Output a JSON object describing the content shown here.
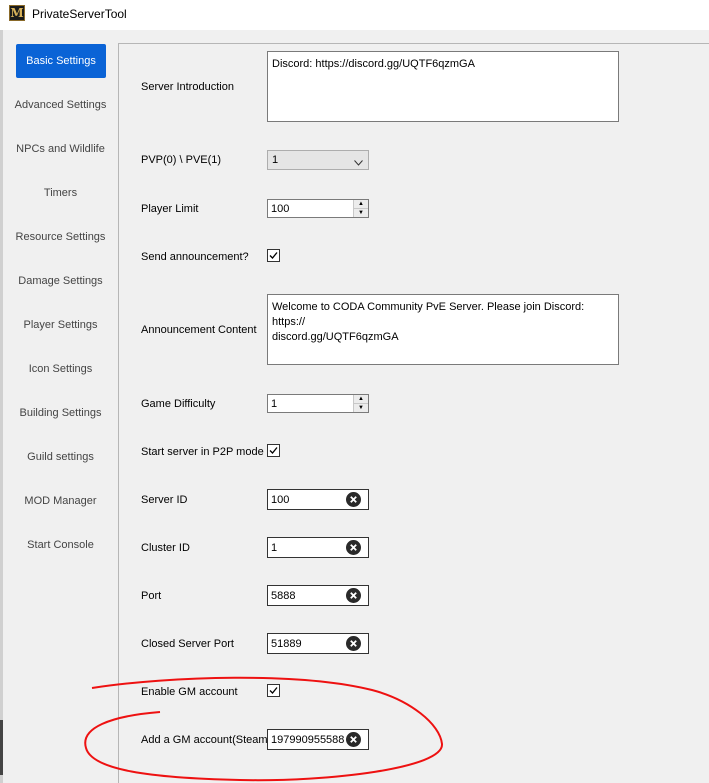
{
  "window": {
    "title": "PrivateServerTool",
    "icon": "app-logo-icon",
    "icon_letter": "M"
  },
  "nav": {
    "items": [
      {
        "label": "Basic Settings",
        "active": true
      },
      {
        "label": "Advanced Settings"
      },
      {
        "label": "NPCs and Wildlife"
      },
      {
        "label": "Timers"
      },
      {
        "label": "Resource Settings"
      },
      {
        "label": "Damage Settings"
      },
      {
        "label": "Player Settings"
      },
      {
        "label": "Icon Settings"
      },
      {
        "label": "Building Settings"
      },
      {
        "label": "Guild settings"
      },
      {
        "label": "MOD Manager"
      },
      {
        "label": "Start Console"
      }
    ]
  },
  "form": {
    "server_intro": {
      "label": "Server Introduction",
      "value": "Discord: https://discord.gg/UQTF6qzmGA"
    },
    "pvp_pve": {
      "label": "PVP(0) \\ PVE(1)",
      "value": "1"
    },
    "player_limit": {
      "label": "Player Limit",
      "value": "100"
    },
    "send_announcement": {
      "label": "Send announcement?",
      "checked": true
    },
    "announcement_content": {
      "label": "Announcement Content",
      "value": "Welcome to CODA Community PvE Server. Please join Discord: https://\ndiscord.gg/UQTF6qzmGA"
    },
    "game_difficulty": {
      "label": "Game Difficulty",
      "value": "1"
    },
    "p2p_mode": {
      "label": "Start server in P2P mode",
      "checked": true
    },
    "server_id": {
      "label": "Server ID",
      "value": "100"
    },
    "cluster_id": {
      "label": "Cluster ID",
      "value": "1"
    },
    "port": {
      "label": "Port",
      "value": "5888"
    },
    "closed_server_port": {
      "label": "Closed Server Port",
      "value": "51889"
    },
    "enable_gm": {
      "label": "Enable GM account",
      "checked": true
    },
    "add_gm": {
      "label": "Add a GM account(Steam",
      "value": "197990955588"
    }
  },
  "annotation": {
    "color": "#ee1111"
  }
}
